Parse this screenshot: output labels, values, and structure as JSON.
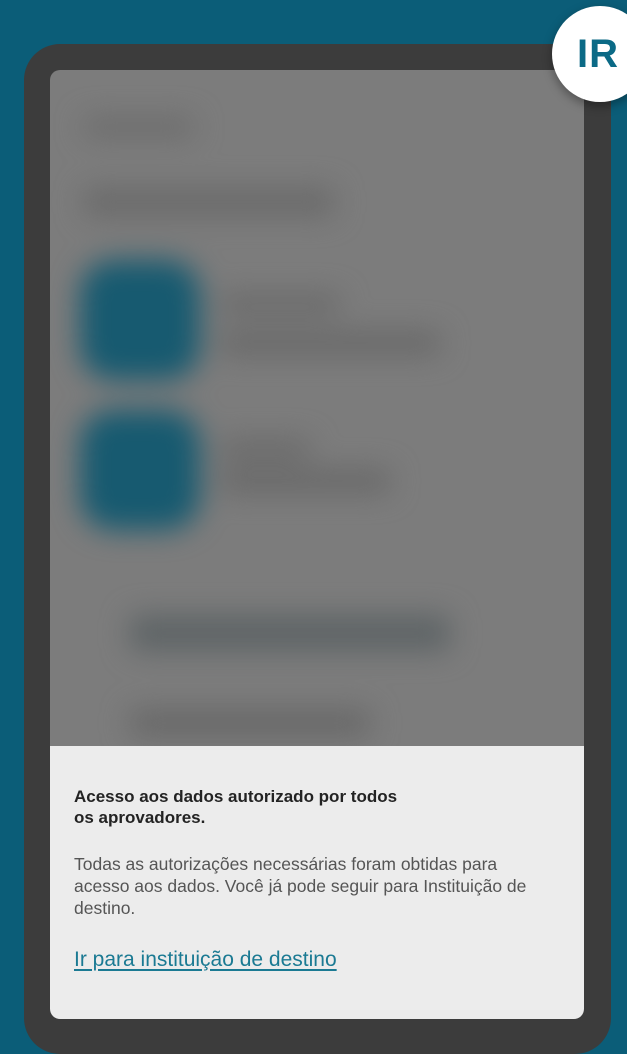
{
  "badge": {
    "label": "IR"
  },
  "sheet": {
    "title": "Acesso aos dados autorizado por todos os aprovadores.",
    "body": "Todas as autorizações necessárias foram obtidas para acesso aos dados. Você já pode seguir para Instituição de destino.",
    "link_label": "Ir para instituição de destino"
  },
  "colors": {
    "page_background": "#0b5d78",
    "phone_frame": "#3c3c3c",
    "blurred_screen": "#7c7c7c",
    "sheet_background": "#ececec",
    "link": "#1b7a93",
    "badge_text": "#0b6a86"
  }
}
